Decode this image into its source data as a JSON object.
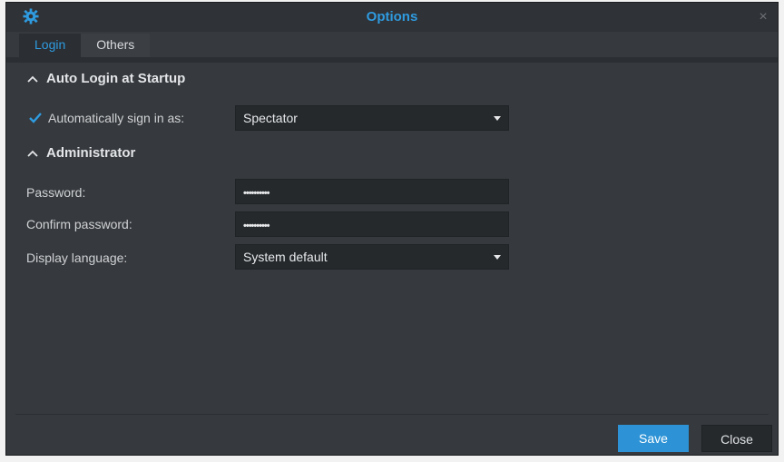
{
  "window": {
    "title": "Options",
    "close_symbol": "×",
    "app_icon": "gear-icon"
  },
  "tabs": [
    {
      "label": "Login",
      "active": true
    },
    {
      "label": "Others",
      "active": false
    }
  ],
  "sections": {
    "auto_login": {
      "title": "Auto Login at Startup",
      "expanded": true,
      "checkbox_label": "Automatically sign in as:",
      "checked": true,
      "user_value": "Spectator"
    },
    "administrator": {
      "title": "Administrator",
      "expanded": true,
      "password_label": "Password:",
      "password_value": "••••••••••",
      "confirm_label": "Confirm password:",
      "confirm_value": "••••••••••",
      "language_label": "Display language:",
      "language_value": "System default"
    }
  },
  "footer": {
    "save_label": "Save",
    "close_label": "Close"
  },
  "colors": {
    "accent": "#2f9be0",
    "background": "#36393d",
    "field": "#26292c"
  }
}
